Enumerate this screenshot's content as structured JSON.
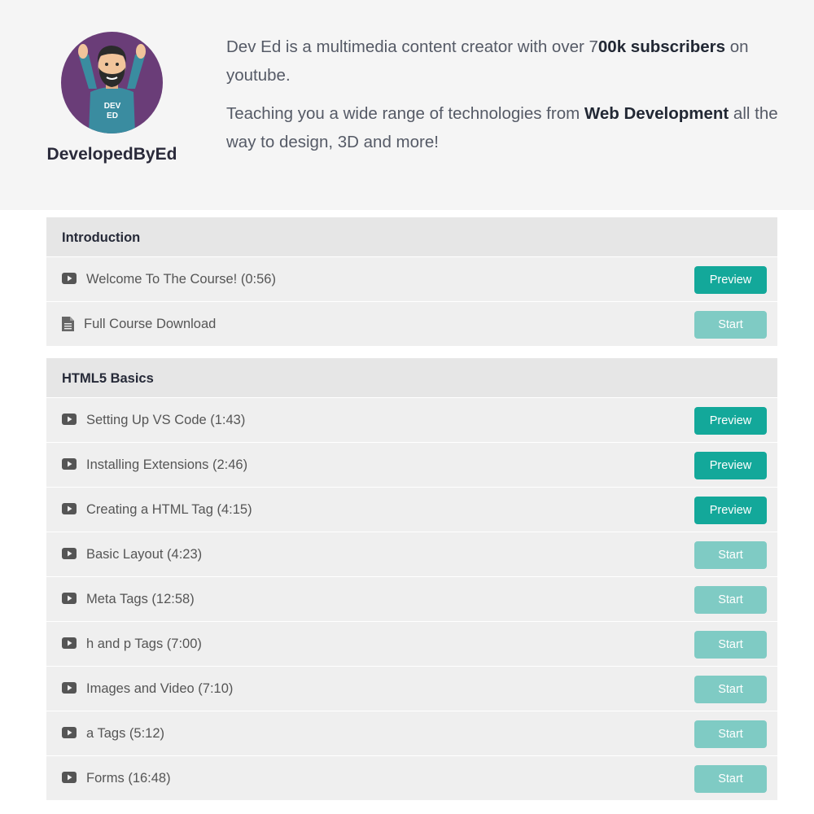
{
  "author": {
    "name": "DevelopedByEd",
    "avatar_shirt_text": [
      "DEV",
      "ED"
    ],
    "bio": [
      {
        "pre": "Dev Ed is a multimedia content creator with over 7",
        "bold": "00k subscribers",
        "post": " on youtube."
      },
      {
        "pre": "Teaching you a wide range of technologies from ",
        "bold": "Web Development",
        "post": " all the way to design, 3D and more!"
      }
    ]
  },
  "icons": {
    "video": "play-icon",
    "file": "document-icon"
  },
  "colors": {
    "preview": "#13a89a",
    "start": "#7fcbc4",
    "header_bg": "#f5f5f5",
    "section_bg": "#efefef"
  },
  "sections": [
    {
      "title": "Introduction",
      "items": [
        {
          "type": "video",
          "label": "Welcome To The Course! (0:56)",
          "button": "Preview"
        },
        {
          "type": "file",
          "label": "Full Course Download",
          "button": "Start"
        }
      ]
    },
    {
      "title": "HTML5 Basics",
      "items": [
        {
          "type": "video",
          "label": "Setting Up VS Code (1:43)",
          "button": "Preview"
        },
        {
          "type": "video",
          "label": "Installing Extensions (2:46)",
          "button": "Preview"
        },
        {
          "type": "video",
          "label": "Creating a HTML Tag (4:15)",
          "button": "Preview"
        },
        {
          "type": "video",
          "label": "Basic Layout (4:23)",
          "button": "Start"
        },
        {
          "type": "video",
          "label": "Meta Tags (12:58)",
          "button": "Start"
        },
        {
          "type": "video",
          "label": "h and p Tags (7:00)",
          "button": "Start"
        },
        {
          "type": "video",
          "label": "Images and Video (7:10)",
          "button": "Start"
        },
        {
          "type": "video",
          "label": "a Tags (5:12)",
          "button": "Start"
        },
        {
          "type": "video",
          "label": "Forms (16:48)",
          "button": "Start"
        }
      ]
    }
  ]
}
